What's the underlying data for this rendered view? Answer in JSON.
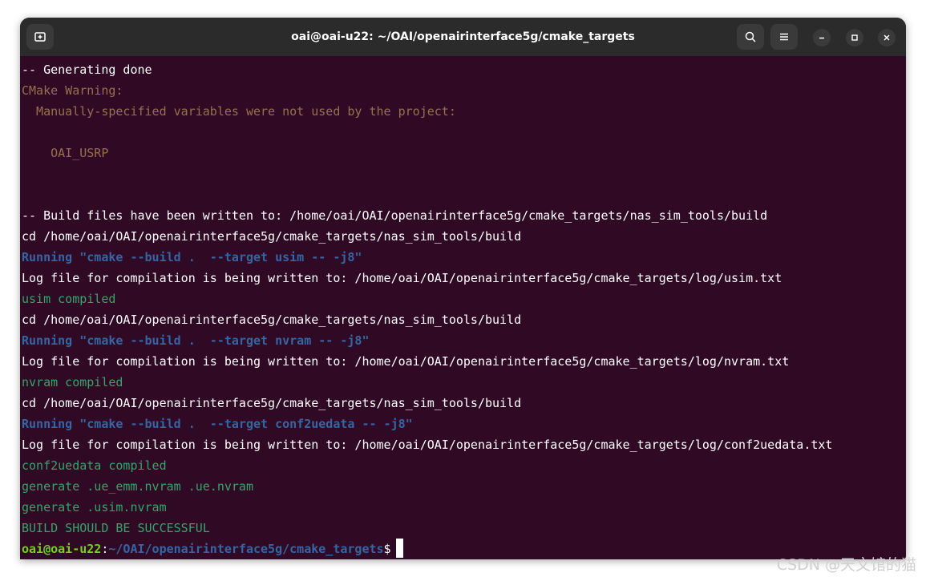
{
  "window": {
    "title": "oai@oai-u22: ~/OAI/openairinterface5g/cmake_targets",
    "icons": {
      "new_tab": "new-tab-icon",
      "search": "search-icon",
      "menu": "hamburger-menu-icon",
      "minimize": "minimize-icon",
      "maximize": "maximize-icon",
      "close": "close-icon"
    }
  },
  "terminal": {
    "lines": [
      {
        "text": "-- Generating done",
        "style": "white"
      },
      {
        "text": "CMake Warning:",
        "style": "warn"
      },
      {
        "text": "  Manually-specified variables were not used by the project:",
        "style": "warn"
      },
      {
        "text": "",
        "style": "white"
      },
      {
        "text": "    OAI_USRP",
        "style": "warn"
      },
      {
        "text": "",
        "style": "white"
      },
      {
        "text": "",
        "style": "white"
      },
      {
        "text": "-- Build files have been written to: /home/oai/OAI/openairinterface5g/cmake_targets/nas_sim_tools/build",
        "style": "white"
      },
      {
        "text": "cd /home/oai/OAI/openairinterface5g/cmake_targets/nas_sim_tools/build",
        "style": "white"
      },
      {
        "text": "Running \"cmake --build .  --target usim -- -j8\"",
        "style": "blue"
      },
      {
        "text": "Log file for compilation is being written to: /home/oai/OAI/openairinterface5g/cmake_targets/log/usim.txt",
        "style": "white"
      },
      {
        "text": "usim compiled",
        "style": "green"
      },
      {
        "text": "cd /home/oai/OAI/openairinterface5g/cmake_targets/nas_sim_tools/build",
        "style": "white"
      },
      {
        "text": "Running \"cmake --build .  --target nvram -- -j8\"",
        "style": "blue"
      },
      {
        "text": "Log file for compilation is being written to: /home/oai/OAI/openairinterface5g/cmake_targets/log/nvram.txt",
        "style": "white"
      },
      {
        "text": "nvram compiled",
        "style": "green"
      },
      {
        "text": "cd /home/oai/OAI/openairinterface5g/cmake_targets/nas_sim_tools/build",
        "style": "white"
      },
      {
        "text": "Running \"cmake --build .  --target conf2uedata -- -j8\"",
        "style": "blue"
      },
      {
        "text": "Log file for compilation is being written to: /home/oai/OAI/openairinterface5g/cmake_targets/log/conf2uedata.txt",
        "style": "white"
      },
      {
        "text": "conf2uedata compiled",
        "style": "green"
      },
      {
        "text": "generate .ue_emm.nvram .ue.nvram",
        "style": "green"
      },
      {
        "text": "generate .usim.nvram",
        "style": "green"
      },
      {
        "text": "BUILD SHOULD BE SUCCESSFUL",
        "style": "green"
      }
    ],
    "prompt": {
      "user_host": "oai@oai-u22",
      "separator": ":",
      "path": "~/OAI/openairinterface5g/cmake_targets",
      "symbol": "$"
    }
  },
  "watermark": "CSDN @天文馆的猫",
  "colors": {
    "background": "#300a24",
    "titlebar": "#2b2b2b",
    "warning": "#b08a57",
    "running": "#3465a4",
    "success": "#33a66a",
    "prompt_user": "#73d216",
    "prompt_path": "#3465a4"
  }
}
